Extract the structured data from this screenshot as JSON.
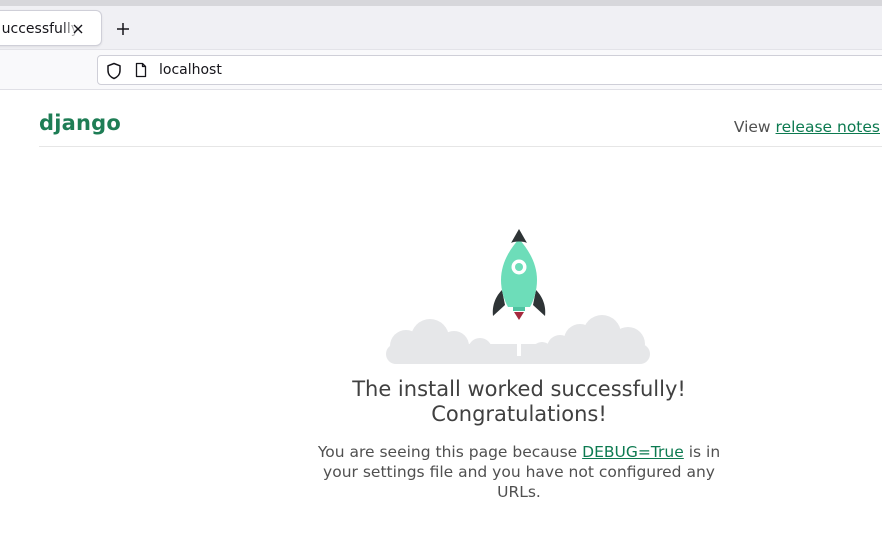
{
  "browser": {
    "tab": {
      "title": "The install worked successfully",
      "close_icon": "close-icon"
    },
    "new_tab_icon": "plus-icon",
    "url": "localhost",
    "icons": {
      "shield": "shield-icon",
      "page": "page-icon"
    }
  },
  "header": {
    "logo": "django",
    "release_prefix": "View ",
    "release_link": "release notes"
  },
  "main": {
    "headline_line1": "The install worked successfully!",
    "headline_line2": "Congratulations!",
    "desc_before": "You are seeing this page because ",
    "desc_link": "DEBUG=True",
    "desc_after": " is in your settings file and you have not configured any URLs."
  },
  "colors": {
    "brand": "#0c4b33",
    "link": "#0c7a50",
    "rocket_body": "#6dddb9",
    "rocket_dark": "#2e3436",
    "flame": "#a5293d",
    "cloud": "#e6e7e9"
  }
}
